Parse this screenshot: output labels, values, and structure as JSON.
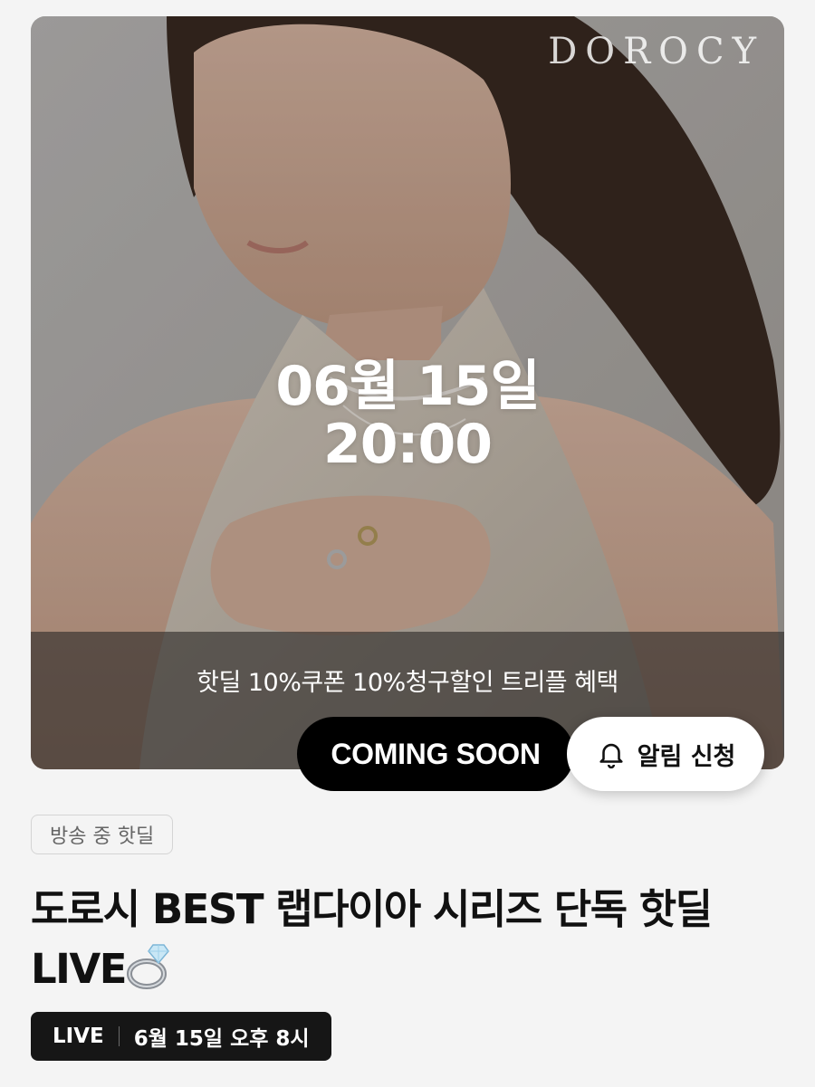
{
  "hero": {
    "brand_logo": "DOROCY",
    "date": "06월 15일",
    "time": "20:00",
    "benefit_text": "핫딜 10%쿠폰 10%청구할인 트리플 혜택"
  },
  "buttons": {
    "status_label": "COMING SOON",
    "alarm_label": "알림 신청",
    "alarm_icon": "bell-icon"
  },
  "info": {
    "tag": "방송 중 핫딜",
    "title": "도로시 BEST 랩다이아 시리즈 단독 핫딜 LIVE",
    "title_emoji_icon": "ring-icon",
    "schedule": {
      "live_label": "LIVE",
      "datetime": "6월 15일 오후 8시"
    }
  },
  "colors": {
    "background": "#f4f4f4",
    "button_dark": "#000000",
    "badge_dark": "#161616",
    "tag_border": "#d4d4d4"
  }
}
